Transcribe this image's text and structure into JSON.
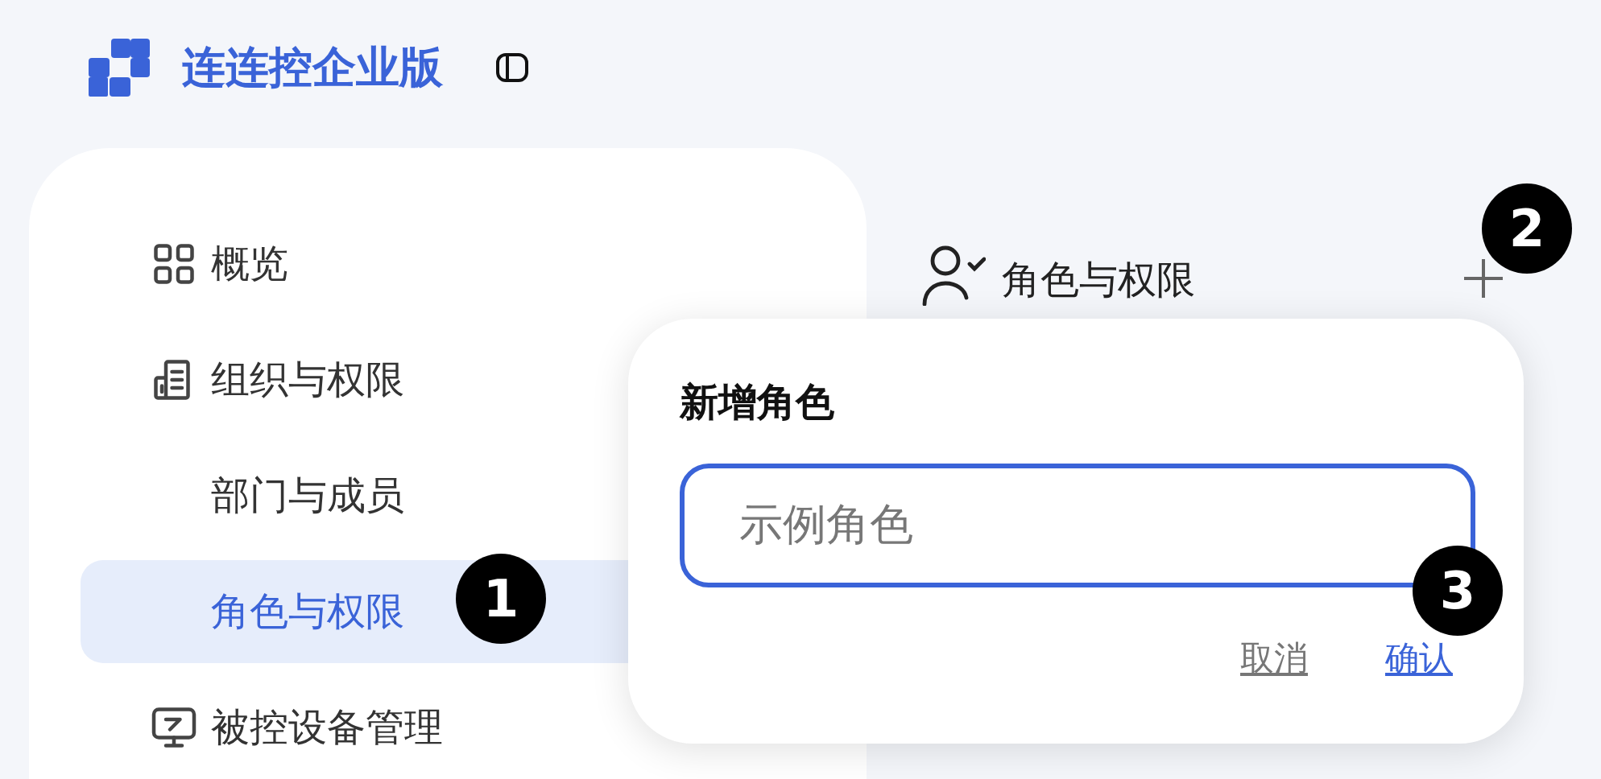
{
  "app": {
    "title": "连连控企业版"
  },
  "sidebar": {
    "items": [
      {
        "label": "概览",
        "selected": false
      },
      {
        "label": "组织与权限",
        "selected": false,
        "children": [
          {
            "label": "部门与成员",
            "selected": false
          },
          {
            "label": "角色与权限",
            "selected": true
          }
        ]
      },
      {
        "label": "被控设备管理",
        "selected": false
      }
    ]
  },
  "panel": {
    "title": "角色与权限"
  },
  "dialog": {
    "title": "新增角色",
    "input": {
      "placeholder": "示例角色",
      "focused": true
    },
    "buttons": [
      {
        "label": "取消",
        "kind": "cancel"
      },
      {
        "label": "确认",
        "kind": "confirm"
      }
    ]
  },
  "callouts": [
    {
      "label": "1"
    },
    {
      "label": "2"
    },
    {
      "label": "3"
    }
  ]
}
